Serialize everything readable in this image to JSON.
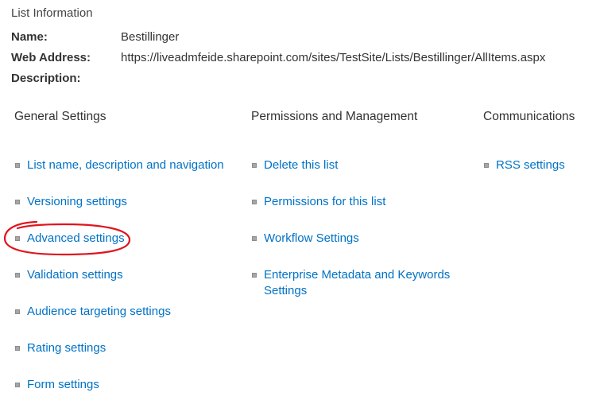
{
  "list_information": {
    "title": "List Information",
    "name_label": "Name:",
    "name_value": "Bestillinger",
    "web_address_label": "Web Address:",
    "web_address_value": "https://liveadmfeide.sharepoint.com/sites/TestSite/Lists/Bestillinger/AllItems.aspx",
    "description_label": "Description:",
    "description_value": ""
  },
  "general_settings": {
    "heading": "General Settings",
    "links": [
      "List name, description and navigation",
      "Versioning settings",
      "Advanced settings",
      "Validation settings",
      "Audience targeting settings",
      "Rating settings",
      "Form settings"
    ]
  },
  "permissions_management": {
    "heading": "Permissions and Management",
    "links": [
      "Delete this list",
      "Permissions for this list",
      "Workflow Settings",
      "Enterprise Metadata and Keywords Settings"
    ]
  },
  "communications": {
    "heading": "Communications",
    "links": [
      "RSS settings"
    ]
  },
  "colors": {
    "link": "#0072c6",
    "text": "#333333",
    "annotation": "#e0141e"
  }
}
